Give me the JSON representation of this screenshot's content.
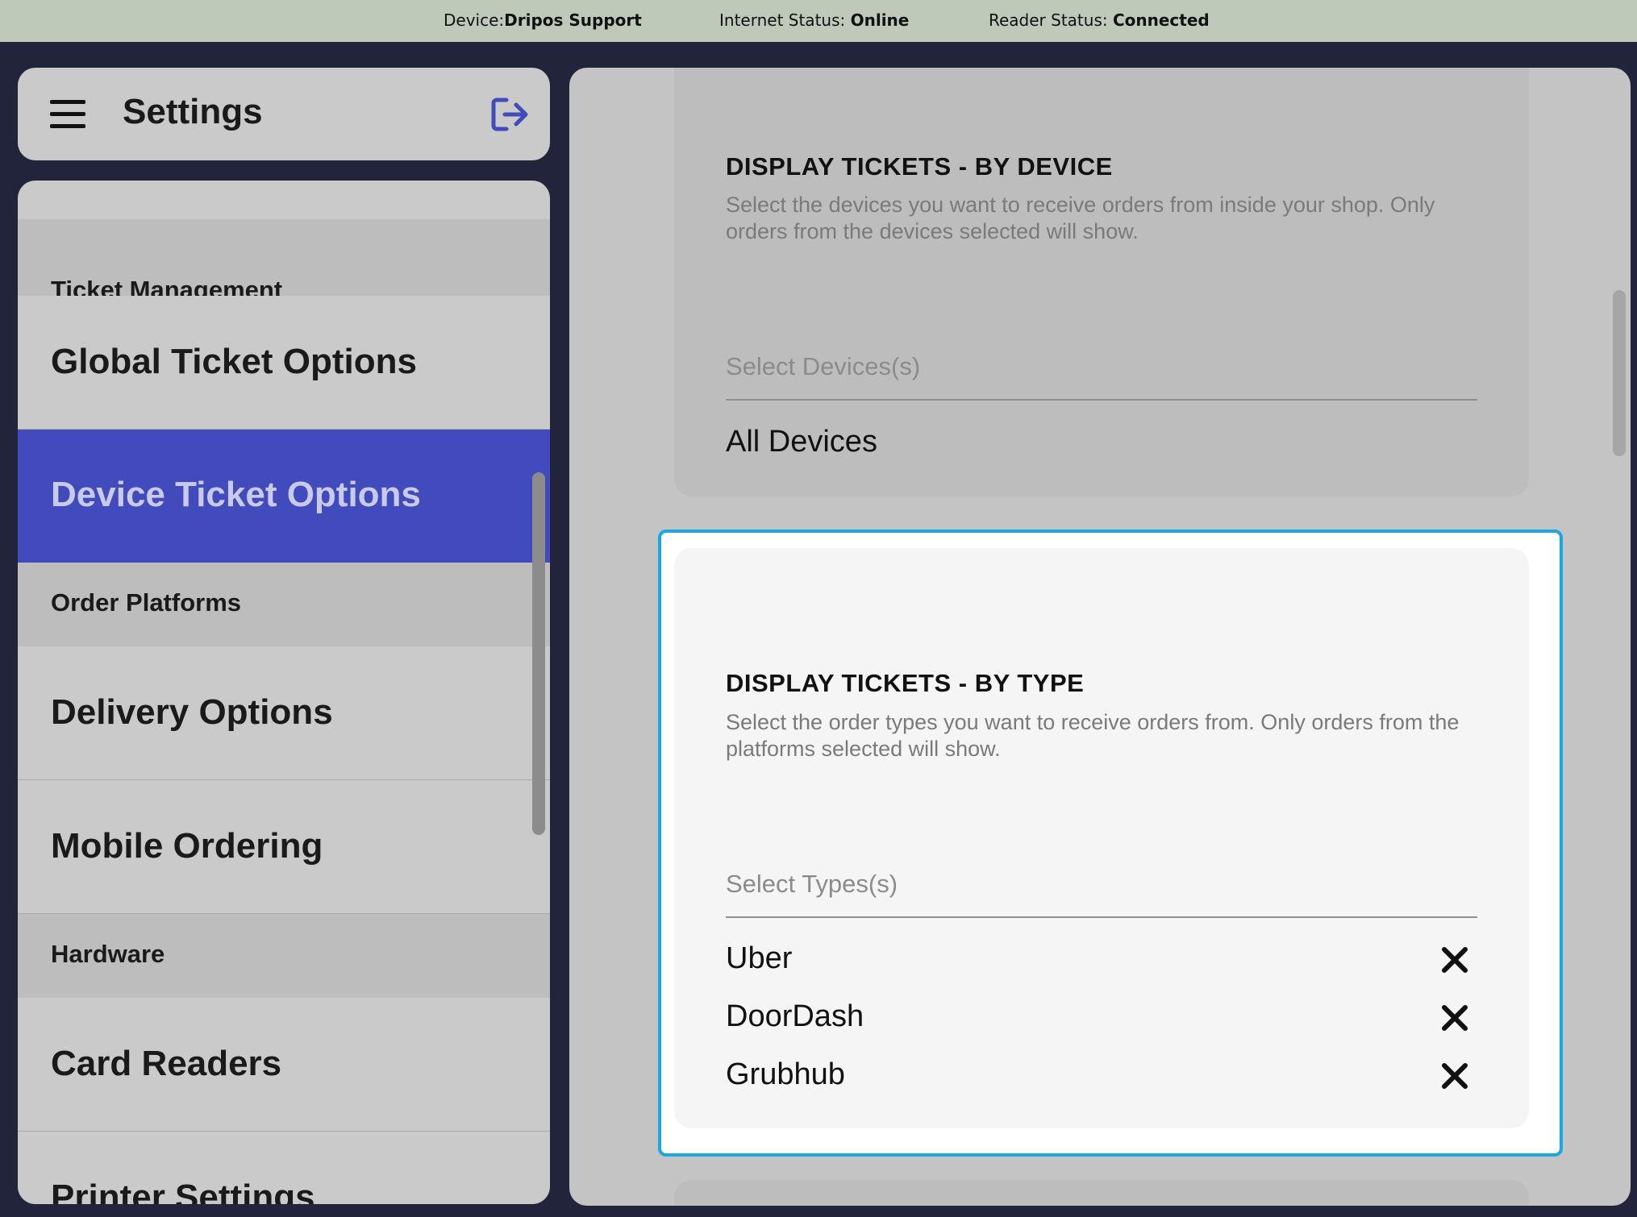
{
  "status": {
    "device_label": "Device:",
    "device_value": "Dripos Support",
    "internet_label": "Internet Status: ",
    "internet_value": "Online",
    "reader_label": "Reader Status: ",
    "reader_value": "Connected"
  },
  "sidebar": {
    "title": "Settings",
    "menu_icon": "hamburger-icon",
    "logout_icon": "logout-icon",
    "accent_color": "#424bbb",
    "sections": [
      {
        "label": "Ticket Management"
      },
      {
        "label": "Order Platforms"
      },
      {
        "label": "Hardware"
      }
    ],
    "items": [
      {
        "label": "Global Ticket Options"
      },
      {
        "label": "Device Ticket Options",
        "active": true
      },
      {
        "label": "Delivery Options"
      },
      {
        "label": "Mobile Ordering"
      },
      {
        "label": "Card Readers"
      },
      {
        "label": "Printer Settings"
      }
    ]
  },
  "by_device": {
    "title": "DISPLAY TICKETS - BY DEVICE",
    "description": "Select the devices you want to receive orders from inside your shop. Only orders from the devices selected will show.",
    "placeholder": "Select Devices(s)",
    "selected": [
      "All Devices"
    ]
  },
  "by_type": {
    "title": "DISPLAY TICKETS - BY TYPE",
    "description": "Select the order types you want to receive orders from. Only orders from the platforms selected will show.",
    "placeholder": "Select Types(s)",
    "selected": [
      "Uber",
      "DoorDash",
      "Grubhub"
    ],
    "remove_icon": "close-icon",
    "focus_color": "#1aa7e3"
  }
}
